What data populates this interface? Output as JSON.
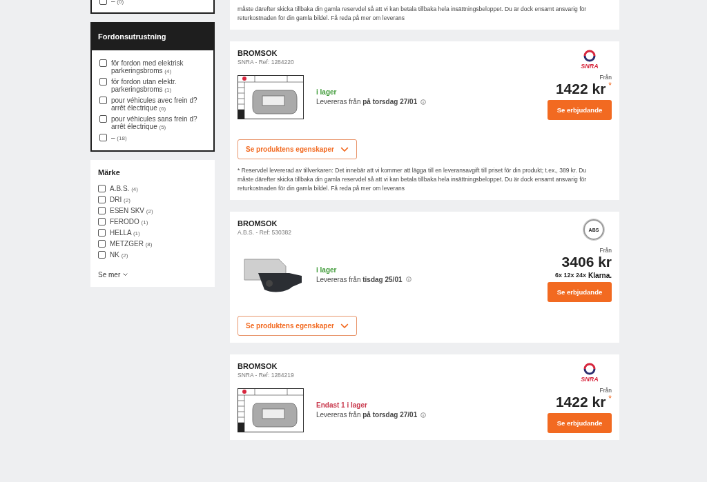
{
  "filters": [
    {
      "kind": "partial",
      "items": [
        {
          "label": "–",
          "count": "(0)",
          "checked": false
        }
      ]
    },
    {
      "kind": "boxed",
      "title": "Fordonsutrustning",
      "items": [
        {
          "label": "för fordon med elektrisk parkeringsbroms",
          "count": "(4)",
          "checked": false
        },
        {
          "label": "för fordon utan elektr. parkeringsbroms",
          "count": "(1)",
          "checked": false
        },
        {
          "label": "pour véhicules avec frein d? arrêt électrique",
          "count": "(6)",
          "checked": false
        },
        {
          "label": "pour véhicules sans frein d? arrêt électrique",
          "count": "(5)",
          "checked": false
        },
        {
          "label": "–",
          "count": "(18)",
          "checked": false
        }
      ]
    },
    {
      "kind": "plain",
      "title": "Märke",
      "more": "Se mer",
      "items": [
        {
          "label": "A.B.S.",
          "count": "(4)",
          "checked": false
        },
        {
          "label": "DRI",
          "count": "(2)",
          "checked": false
        },
        {
          "label": "ESEN SKV",
          "count": "(2)",
          "checked": false
        },
        {
          "label": "FERODO",
          "count": "(1)",
          "checked": false
        },
        {
          "label": "HELLA",
          "count": "(1)",
          "checked": false
        },
        {
          "label": "METZGER",
          "count": "(8)",
          "checked": false
        },
        {
          "label": "NK",
          "count": "(2)",
          "checked": false
        }
      ]
    }
  ],
  "top_notice": "måste därefter skicka tillbaka din gamla reservdel så att vi kan betala tillbaka hela insättningsbeloppet. Du är dock ensamt ansvarig för returkostnaden för din gamla bildel. Få reda på mer om leverans",
  "products": [
    {
      "title": "BROMSOK",
      "ref": "SNRA - Ref: 1284220",
      "brand": {
        "kind": "snra",
        "text": "SNRA"
      },
      "image": {
        "kind": "datasheet"
      },
      "stock": {
        "kind": "in",
        "text": "i lager"
      },
      "delivery": "Levereras från **på torsdag 27/01**",
      "from": "Från",
      "price": "1422 kr",
      "asterisk": "*",
      "offer": "Se erbjudande",
      "details": "Se produktens egenskaper",
      "notice": "* Reservdel levererad av tillverkaren: Det innebär att vi kommer att lägga till en leveransavgift till priset för din produkt; t.ex., 389 kr. Du måste därefter skicka tillbaka din gamla reservdel så att vi kan betala tillbaka hela insättningsbeloppet. Du är dock ensamt ansvarig för returkostnaden för din gamla bildel. Få reda på mer om leverans"
    },
    {
      "title": "BROMSOK",
      "ref": "A.B.S. - Ref: 530382",
      "brand": {
        "kind": "abs",
        "text": "ABS"
      },
      "image": {
        "kind": "photo"
      },
      "stock": {
        "kind": "in",
        "text": "i lager"
      },
      "delivery": "Levereras från **tisdag 25/01**",
      "from": "Från",
      "price": "3406 kr",
      "installments": "6x 12x 24x",
      "klarna": "Klarna.",
      "offer": "Se erbjudande",
      "details": "Se produktens egenskaper"
    },
    {
      "title": "BROMSOK",
      "ref": "SNRA - Ref: 1284219",
      "brand": {
        "kind": "snra",
        "text": "SNRA"
      },
      "image": {
        "kind": "datasheet"
      },
      "stock": {
        "kind": "low",
        "text": "Endast 1 i lager"
      },
      "delivery": "Levereras från **på torsdag 27/01**",
      "from": "Från",
      "price": "1422 kr",
      "asterisk": "*",
      "offer": "Se erbjudande"
    }
  ]
}
